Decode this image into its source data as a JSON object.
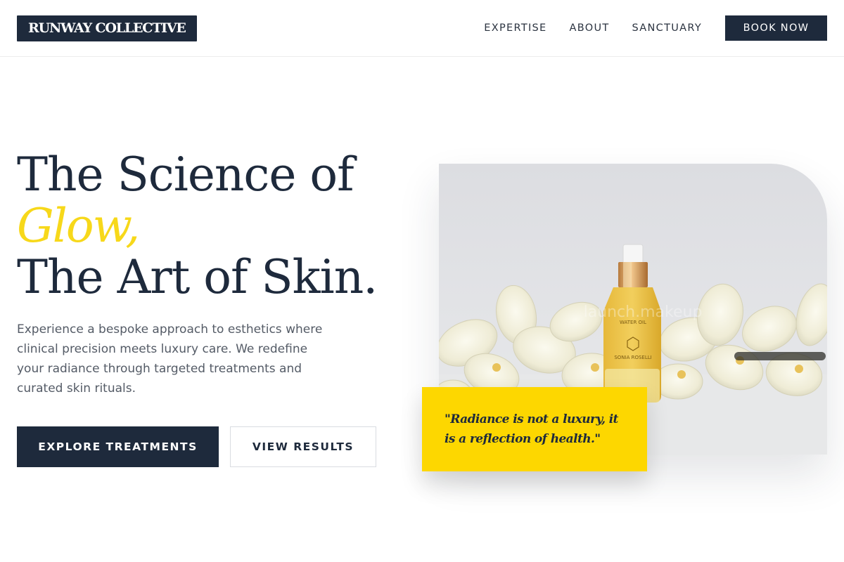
{
  "brand": {
    "logo_text": "RUNWAY COLLECTIVE"
  },
  "nav": {
    "links": [
      "EXPERTISE",
      "ABOUT",
      "SANCTUARY"
    ],
    "cta_label": "BOOK NOW"
  },
  "hero": {
    "headline_line1": "The Science of",
    "headline_accent": "Glow,",
    "headline_line3": "The Art of Skin.",
    "lead": "Experience a bespoke approach to esthetics where clinical precision meets luxury care. We redefine your radiance through targeted treatments and curated skin rituals.",
    "primary_button": "EXPLORE TREATMENTS",
    "secondary_button": "VIEW RESULTS",
    "quote": "\"Radiance is not a luxury, it is a reflection of health.\"",
    "image": {
      "bottle_label_1": "WATER OIL",
      "bottle_label_2": "SONIA ROSELLI",
      "watermark": "launch.makeup"
    }
  },
  "colors": {
    "navy": "#1e2a3c",
    "accent_yellow": "#fdd700",
    "glow_yellow": "#f7d81a",
    "body_text": "#545b66"
  }
}
